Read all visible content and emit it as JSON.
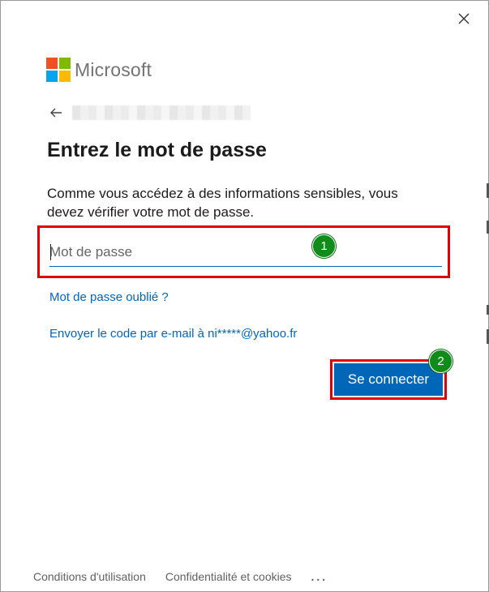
{
  "window": {
    "close_icon": "close-icon"
  },
  "brand": {
    "name": "Microsoft",
    "logo_colors": [
      "#f25022",
      "#7fba00",
      "#00a4ef",
      "#ffb900"
    ]
  },
  "identity": {
    "back_icon": "arrow-left-icon",
    "email_masked": ""
  },
  "heading": "Entrez le mot de passe",
  "description": "Comme vous accédez à des informations sensibles, vous devez vérifier votre mot de passe.",
  "password": {
    "placeholder": "Mot de passe",
    "value": ""
  },
  "links": {
    "forgot_password": "Mot de passe oublié ?",
    "email_code": "Envoyer le code par e-mail à ni*****@yahoo.fr"
  },
  "submit_label": "Se connecter",
  "annotations": {
    "badge_1": "1",
    "badge_2": "2",
    "highlight_color": "#e00000",
    "badge_color": "#108c1b"
  },
  "footer": {
    "terms": "Conditions d'utilisation",
    "privacy": "Confidentialité et cookies",
    "more": "..."
  },
  "colors": {
    "accent": "#0067b8",
    "text": "#1b1b1b",
    "muted": "#616161"
  }
}
